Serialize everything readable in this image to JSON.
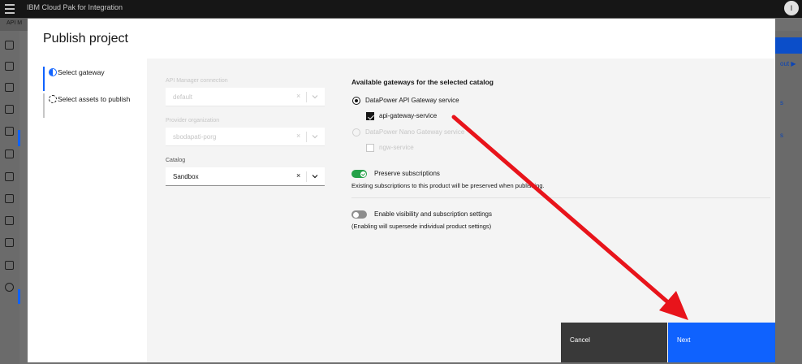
{
  "app": {
    "title": "IBM Cloud Pak for Integration",
    "avatar_initial": "I",
    "bg_tab": "API M"
  },
  "bg_right": {
    "text1": "out ▶",
    "text2": "s",
    "text3": "s"
  },
  "modal": {
    "title": "Publish project"
  },
  "steps": [
    {
      "label": "Select gateway",
      "state": "current"
    },
    {
      "label": "Select assets to publish",
      "state": "incomplete"
    }
  ],
  "form": {
    "connection": {
      "label": "API Manager connection",
      "value": "default",
      "disabled": true
    },
    "org": {
      "label": "Provider organization",
      "value": "sbodapati-porg",
      "disabled": true
    },
    "catalog": {
      "label": "Catalog",
      "value": "Sandbox",
      "disabled": false
    },
    "clear_glyph": "×"
  },
  "gateways": {
    "title": "Available gateways for the selected catalog",
    "options": [
      {
        "label": "DataPower API Gateway service",
        "checked": true,
        "service": "api-gateway-service",
        "service_checked": true
      },
      {
        "label": "DataPower Nano Gateway service",
        "checked": false,
        "disabled": true,
        "service": "ngw-service",
        "service_checked": false
      }
    ]
  },
  "preserve": {
    "label": "Preserve subscriptions",
    "on": true,
    "helper": "Existing subscriptions to this product will be preserved when publishing."
  },
  "visibility": {
    "label": "Enable visibility and subscription settings",
    "on": false,
    "helper": "(Enabling will supersede individual product settings)"
  },
  "footer": {
    "cancel_label": "Cancel",
    "next_label": "Next"
  },
  "colors": {
    "primary": "#0f62fe",
    "toggle_on": "#24a148",
    "annotation": "#e8141b"
  }
}
